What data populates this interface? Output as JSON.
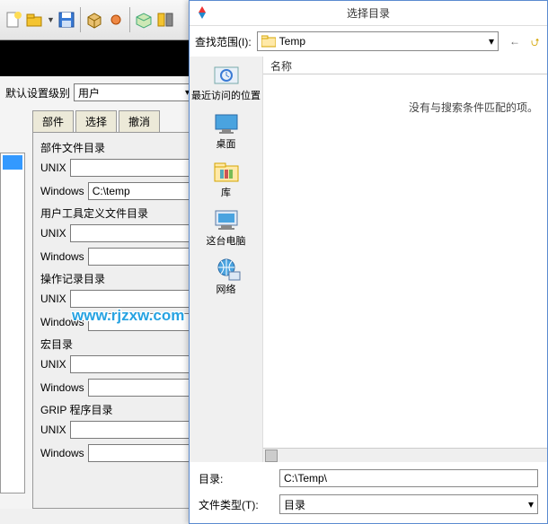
{
  "toolbar_icons": [
    "new",
    "open",
    "save",
    "box",
    "dot",
    "pkg",
    "merge"
  ],
  "settings": {
    "level_label": "默认设置级别",
    "level_value": "用户"
  },
  "tabs": [
    "部件",
    "选择",
    "撤消"
  ],
  "form": {
    "sections": [
      {
        "title": "部件文件目录",
        "unix": "",
        "windows": "C:\\temp"
      },
      {
        "title": "用户工具定义文件目录",
        "unix": "",
        "windows": ""
      },
      {
        "title": "操作记录目录",
        "unix": "",
        "windows": ""
      },
      {
        "title": "宏目录",
        "unix": "",
        "windows": ""
      },
      {
        "title": "GRIP 程序目录",
        "unix": "",
        "windows": ""
      }
    ],
    "unix_label": "UNIX",
    "windows_label": "Windows"
  },
  "watermark": "www.rjzxw.com",
  "dialog": {
    "title": "选择目录",
    "look_in_label": "查找范围(I):",
    "look_in_value": "Temp",
    "places": [
      {
        "name": "recent",
        "label": "最近访问的位置"
      },
      {
        "name": "desktop",
        "label": "桌面"
      },
      {
        "name": "libraries",
        "label": "库"
      },
      {
        "name": "computer",
        "label": "这台电脑"
      },
      {
        "name": "network",
        "label": "网络"
      }
    ],
    "col_name": "名称",
    "empty_msg": "没有与搜索条件匹配的项。",
    "dir_label": "目录:",
    "dir_value": "C:\\Temp\\",
    "type_label": "文件类型(T):",
    "type_value": "目录"
  }
}
